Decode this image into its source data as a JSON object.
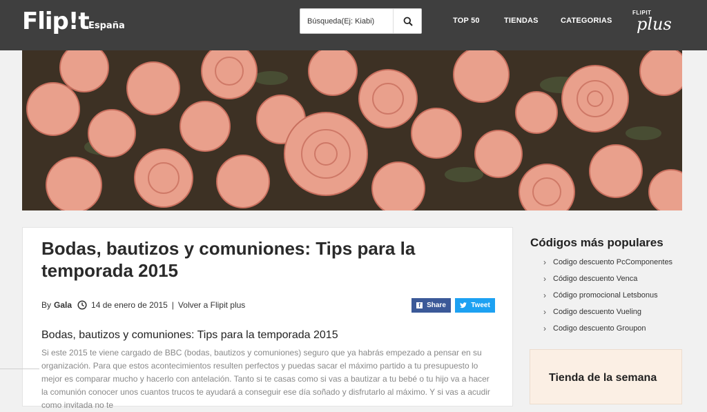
{
  "header": {
    "logo": "Flip!t",
    "country": "España",
    "search_placeholder": "Búsqueda(Ej: Kiabi)",
    "nav": [
      "TOP 50",
      "TIENDAS",
      "CATEGORIAS"
    ],
    "plus_small": "FLIPIT",
    "plus_big": "plus"
  },
  "article": {
    "title": "Bodas, bautizos y comuniones: Tips para la temporada 2015",
    "by": "By",
    "author": "Gala",
    "date": "14 de enero de 2015",
    "separator": "|",
    "back_link": "Volver a Flipit plus",
    "share_label": "Share",
    "tweet_label": "Tweet",
    "subtitle": "Bodas, bautizos y comuniones: Tips para la temporada 2015",
    "body": "Si este 2015 te viene cargado de BBC (bodas, bautizos y comuniones) seguro que ya habrás empezado a pensar en su organización. Para que estos acontecimientos resulten perfectos y puedas sacar el máximo partido a tu presupuesto lo mejor es comparar mucho y hacerlo con antelación. Tanto si te casas como si vas a bautizar a tu bebé o tu hijo va a hacer la comunión conocer unos cuantos trucos te ayudará a conseguir ese día soñado y disfrutarlo al máximo. Y si vas a acudir como invitada no te"
  },
  "sidebar": {
    "title": "Códigos más populares",
    "items": [
      "Codigo descuento PcComponentes",
      "Código descuento Venca",
      "Código promocional Letsbonus",
      "Codigo descuento Vueling",
      "Codigo descuento Groupon"
    ],
    "tienda_title": "Tienda de la semana"
  },
  "colors": {
    "header_bg": "#3f3f3f",
    "facebook": "#3b5998",
    "twitter": "#1da1f2",
    "tienda_bg": "#fbefe4"
  }
}
